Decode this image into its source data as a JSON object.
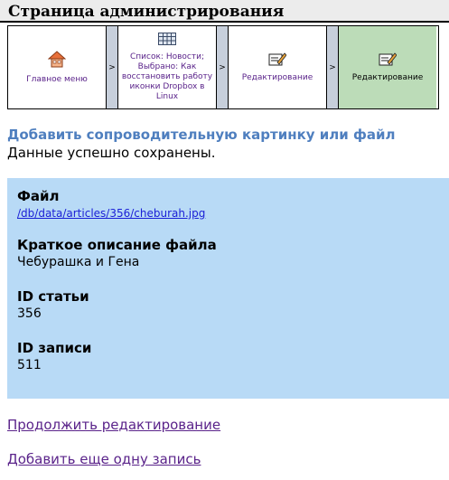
{
  "header": {
    "title": "Страница администрирования"
  },
  "breadcrumb": {
    "items": [
      {
        "label": "Главное меню",
        "icon": "home-icon"
      },
      {
        "label": "Список: Новости; Выбрано: Как восстановить работу иконки Dropbox в Linux",
        "icon": "table-icon"
      },
      {
        "label": "Редактирование",
        "icon": "edit-icon"
      },
      {
        "label": "Редактирование",
        "icon": "edit-icon"
      }
    ],
    "separator": ">"
  },
  "main": {
    "section_title": "Добавить сопроводительную картинку или файл",
    "status": "Данные успешно сохранены.",
    "fields": [
      {
        "label": "Файл",
        "value": "/db/data/articles/356/cheburah.jpg"
      },
      {
        "label": "Краткое описание файла",
        "value": "Чебурашка и Гена"
      },
      {
        "label": "ID статьи",
        "value": "356"
      },
      {
        "label": "ID записи",
        "value": "511"
      }
    ],
    "links": {
      "continue": "Продолжить редактирование",
      "add_another": "Добавить еще одну запись"
    }
  },
  "colors": {
    "header_bg": "#ececec",
    "panel_bg": "#b8daf6",
    "title_blue": "#4f7fbf",
    "active_crumb_bg": "#bcdcb8",
    "separator_bg": "#c7cfdb",
    "link_visited": "#5a238a",
    "link": "#1a1fd6"
  }
}
